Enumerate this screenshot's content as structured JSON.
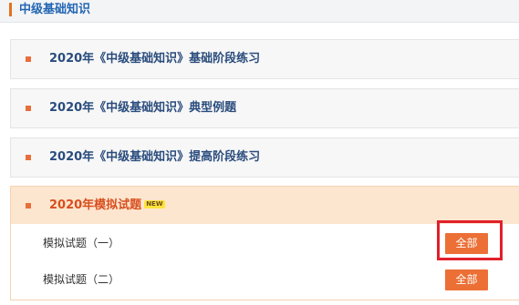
{
  "header": {
    "title": "中级基础知识"
  },
  "sections": [
    {
      "title": "2020年《中级基础知识》基础阶段练习"
    },
    {
      "title": "2020年《中级基础知识》典型例题"
    },
    {
      "title": "2020年《中级基础知识》提高阶段练习"
    },
    {
      "title": "2020年模拟试题",
      "badge": "NEW",
      "expanded": true
    }
  ],
  "sub_items": [
    {
      "label": "模拟试题（一）",
      "button": "全部"
    },
    {
      "label": "模拟试题（二）",
      "button": "全部"
    }
  ],
  "colors": {
    "accent": "#ec6f35",
    "header_title": "#2366b3",
    "section_title": "#2a4c7d",
    "active_title": "#d84f1f",
    "highlight": "#e0202a"
  }
}
